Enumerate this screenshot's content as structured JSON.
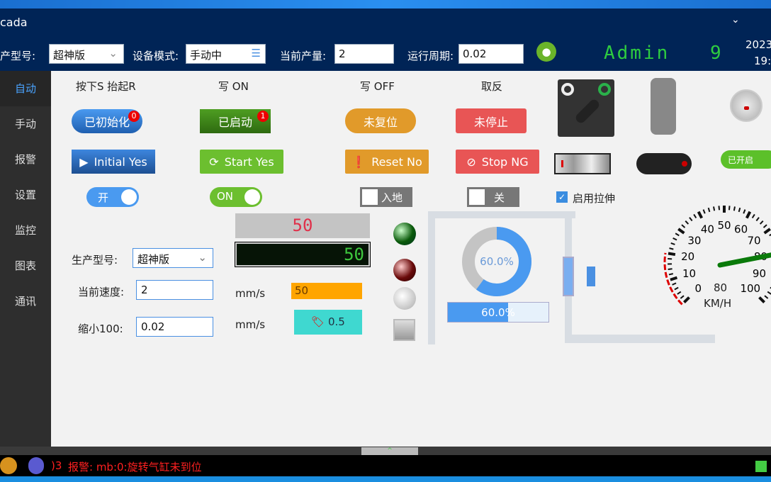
{
  "window": {
    "title": "cada"
  },
  "header": {
    "model_label": "产型号:",
    "model_value": "超神版",
    "mode_label": "设备模式:",
    "mode_value": "手动中",
    "output_label": "当前产量:",
    "output_value": "2",
    "cycle_label": "运行周期:",
    "cycle_value": "0.02",
    "user": "Admin",
    "user_level": "9",
    "date": "2023",
    "time": "19:"
  },
  "sidebar": {
    "items": [
      {
        "label": "自动",
        "active": true
      },
      {
        "label": "手动"
      },
      {
        "label": "报警"
      },
      {
        "label": "设置"
      },
      {
        "label": "监控"
      },
      {
        "label": "图表"
      },
      {
        "label": "通讯"
      }
    ]
  },
  "main": {
    "col_headers": [
      "按下S 抬起R",
      "写 ON",
      "写 OFF",
      "取反"
    ],
    "state_buttons": [
      {
        "label": "已初始化",
        "badge": "0",
        "color": "#2f7fd8"
      },
      {
        "label": "已启动",
        "badge": "1",
        "color": "#3e8a1a"
      },
      {
        "label": "未复位",
        "color": "#e19a2a"
      },
      {
        "label": "未停止",
        "color": "#e85555"
      }
    ],
    "action_buttons": [
      {
        "label": "Initial Yes",
        "icon": "play-icon"
      },
      {
        "label": "Start Yes",
        "icon": "refresh-icon"
      },
      {
        "label": "Reset No",
        "icon": "exclamation-icon"
      },
      {
        "label": "Stop NG",
        "icon": "ban-icon"
      }
    ],
    "toggles": {
      "kai": "开",
      "on": "ON",
      "rudi": "入地",
      "guan": "关",
      "enabled": "已开启"
    },
    "checkbox": {
      "label": "启用拉伸",
      "checked": true
    },
    "form": {
      "model_label": "生产型号:",
      "model_value": "超神版",
      "speed_label": "当前速度:",
      "speed_value": "2",
      "scale_label": "缩小100:",
      "scale_value": "0.02"
    },
    "led_top": "50",
    "led_bottom": "50",
    "unit1": "mm/s",
    "unit2": "mm/s",
    "bar_value": "50",
    "tag_value": "0.5",
    "ring_progress": "60.0%",
    "bar_progress": "60.0%",
    "progress": 0.6
  },
  "gauge": {
    "ticks": [
      "0",
      "10",
      "20",
      "30",
      "40",
      "50",
      "60",
      "70",
      "80",
      "90",
      "100"
    ],
    "value": "80",
    "unit": "KM/H",
    "min": 0,
    "max": 100
  },
  "status": {
    "alarm_code": ")3",
    "alarm_text": "报警: mb:0:旋转气缸未到位"
  },
  "colors": {
    "header": "#002456",
    "sidebar": "#2e2e2e",
    "accent": "#4aa3ff",
    "alarm": "#ff2020"
  }
}
